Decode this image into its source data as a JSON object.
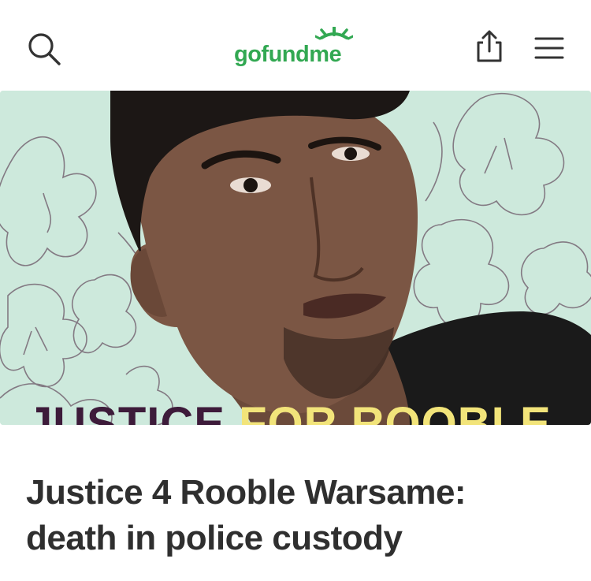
{
  "header": {
    "logo_text": "gofundme",
    "brand_color": "#32a852",
    "icons": {
      "search": "search-icon",
      "share": "share-icon",
      "menu": "hamburger-menu-icon"
    }
  },
  "hero": {
    "background_color": "#cde9dc",
    "caption_part1": "JUSTICE",
    "caption_part2": "FOR ROOBLE",
    "caption_colors": [
      "#3d1b3a",
      "#f2e47a"
    ]
  },
  "campaign": {
    "title_line1": "Justice 4 Rooble Warsame:",
    "title_line2": "death in police custody"
  }
}
